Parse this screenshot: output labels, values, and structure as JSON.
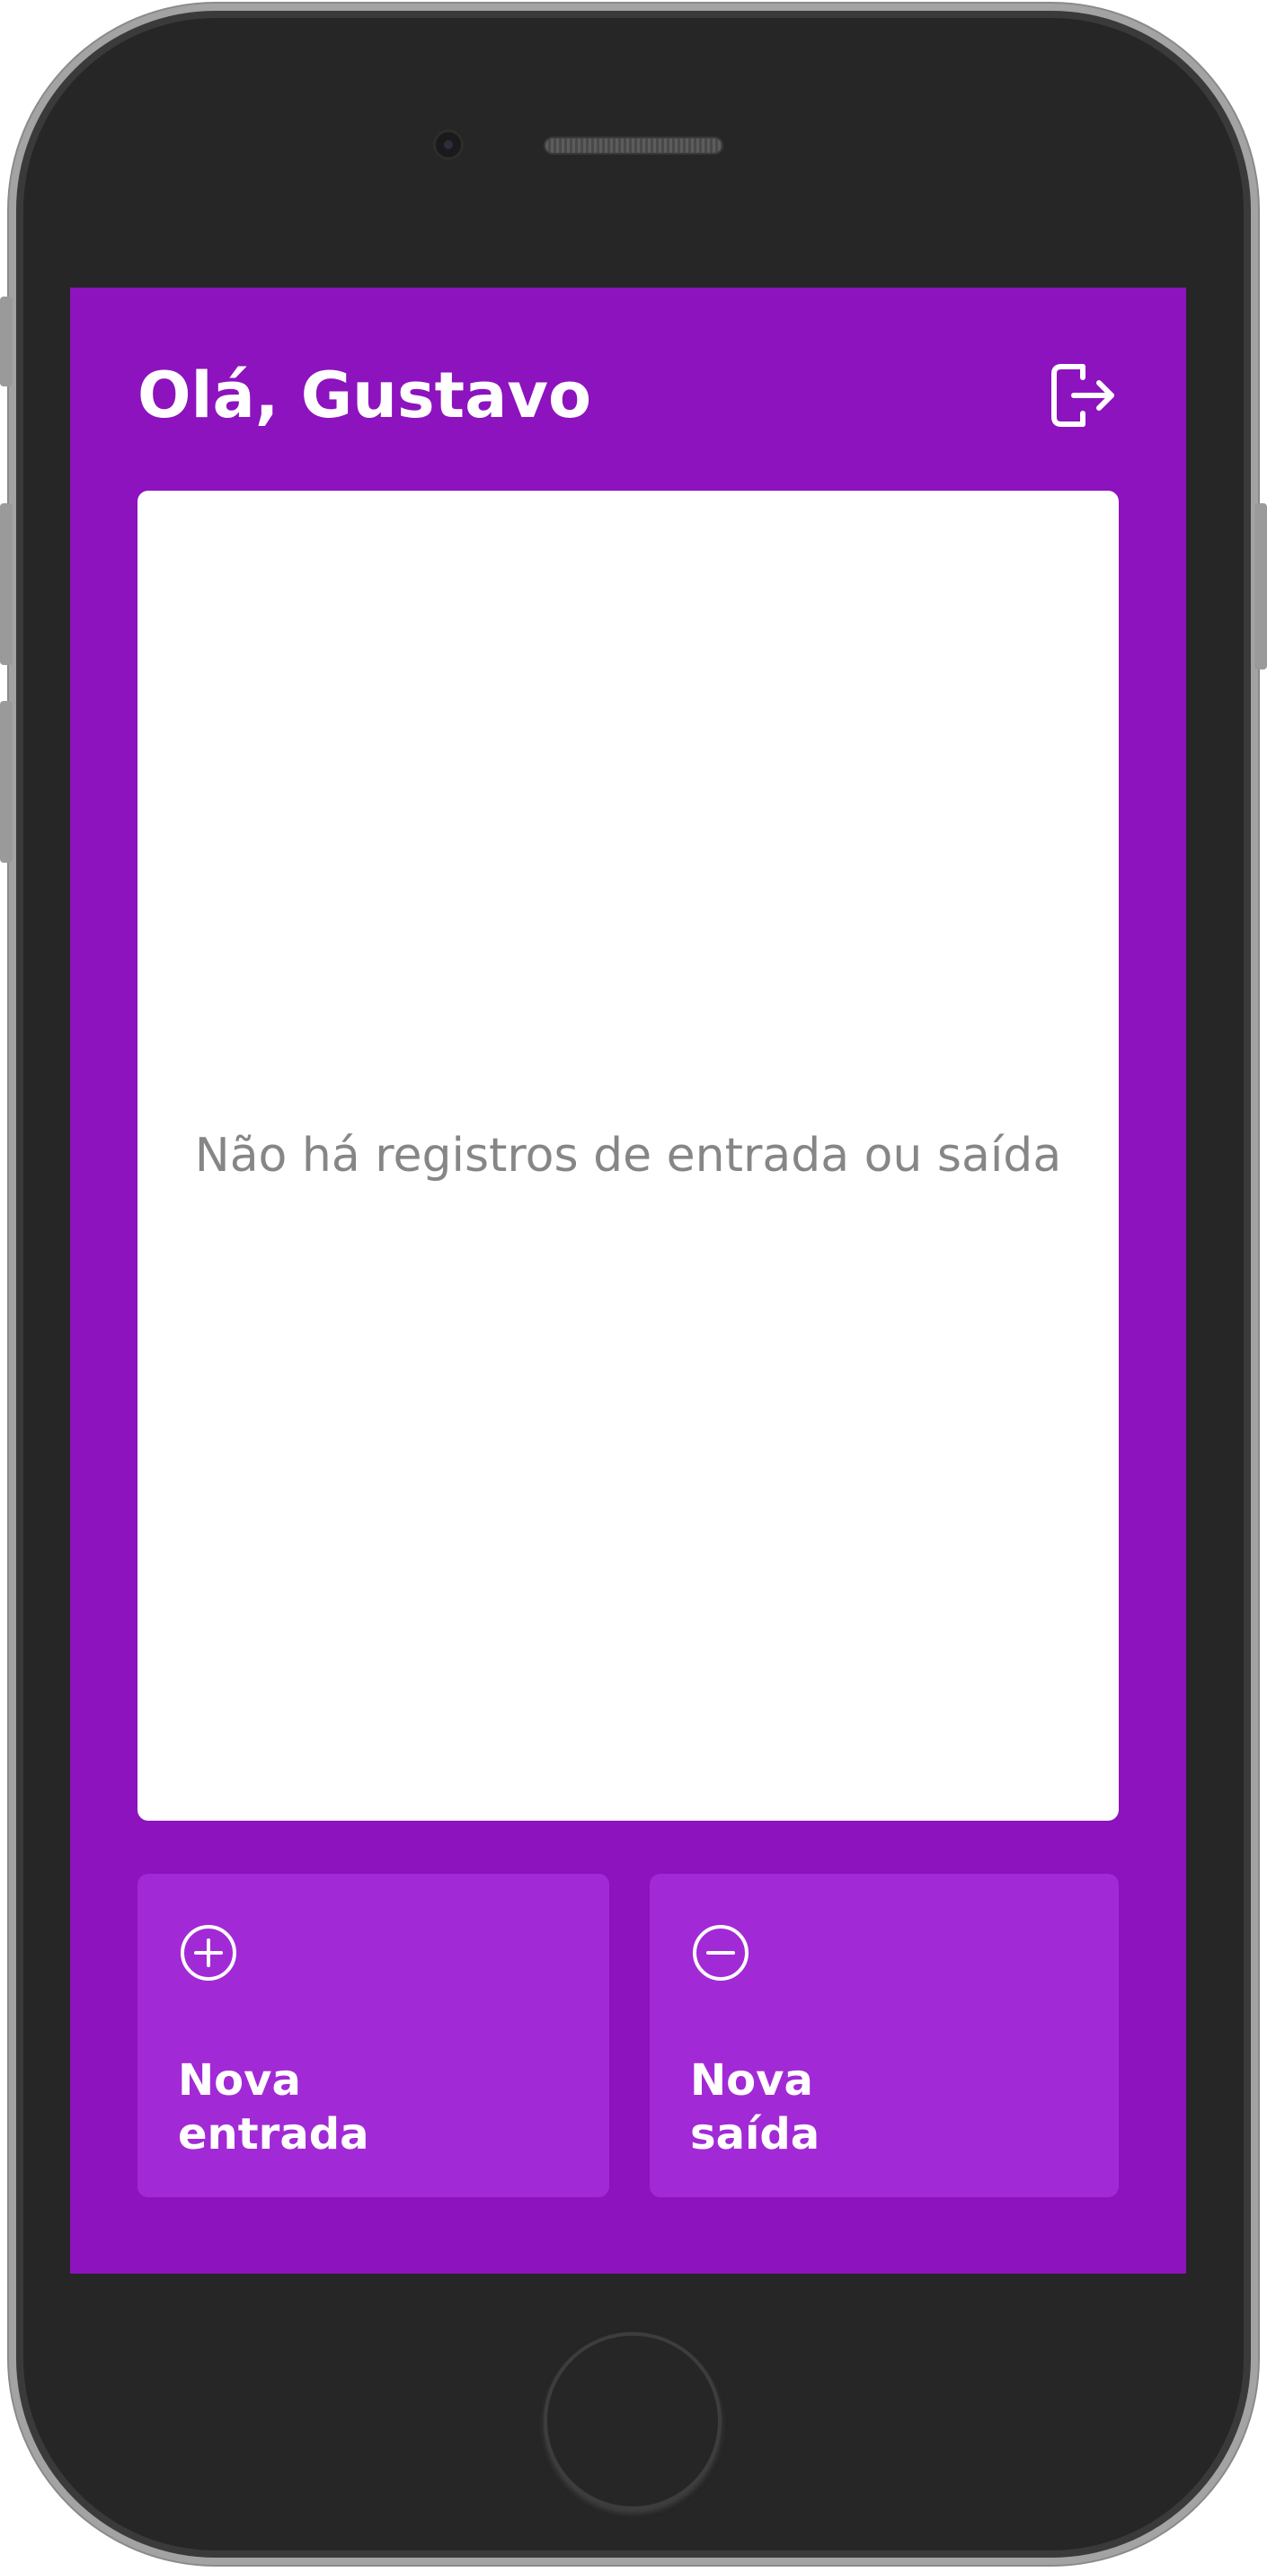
{
  "header": {
    "greeting": "Olá, Gustavo",
    "logout_icon": "logout-icon"
  },
  "records": {
    "empty_message": "Não há registros de entrada ou saída"
  },
  "actions": {
    "new_entry": {
      "icon": "plus-circle-icon",
      "line1": "Nova",
      "line2": "entrada"
    },
    "new_exit": {
      "icon": "minus-circle-icon",
      "line1": "Nova",
      "line2": "saída"
    }
  },
  "colors": {
    "background": "#8c13be",
    "button": "#a22ad6",
    "panel": "#ffffff",
    "empty_text": "#868686"
  }
}
